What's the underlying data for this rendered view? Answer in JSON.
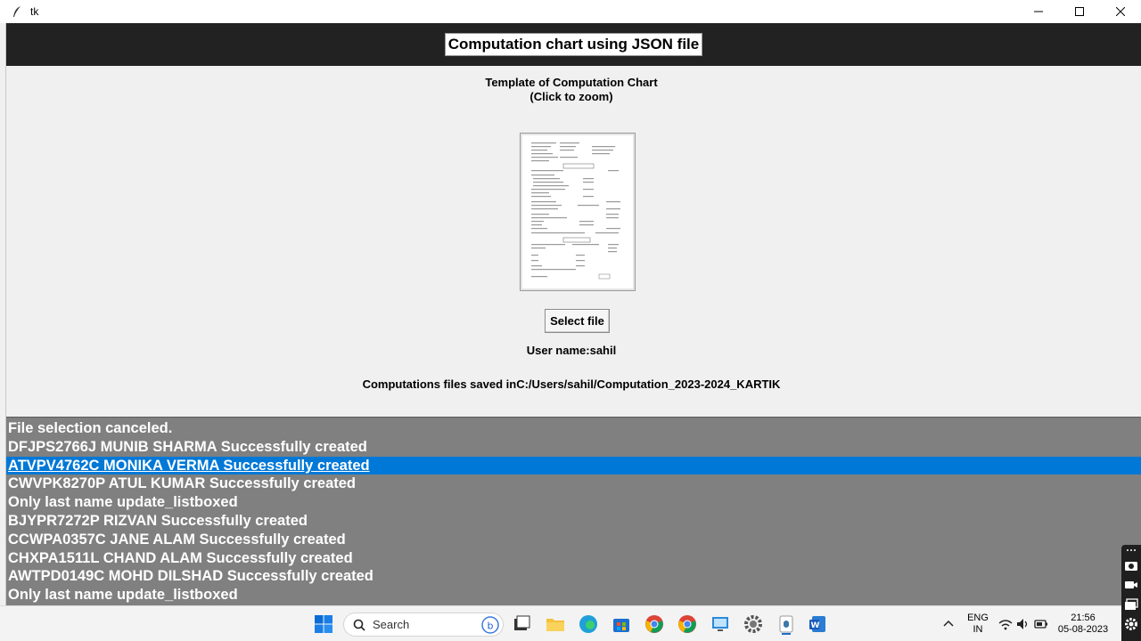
{
  "window": {
    "title": "tk"
  },
  "header": {
    "title": "Computation chart using JSON file"
  },
  "template": {
    "caption_line1": "Template of Computation Chart",
    "caption_line2": "(Click to zoom)"
  },
  "buttons": {
    "select_file": "Select file"
  },
  "user": {
    "label": "User name:sahil"
  },
  "saved": {
    "label": "Computations files saved inC:/Users/sahil/Computation_2023-2024_KARTIK"
  },
  "listbox": {
    "items": [
      "File selection canceled.",
      "DFJPS2766J MUNIB SHARMA  Successfully created",
      "ATVPV4762C MONIKA VERMA  Successfully created",
      "CWVPK8270P ATUL KUMAR  Successfully created",
      "Only last name update_listboxed",
      "BJYPR7272P  RIZVAN  Successfully created",
      "CCWPA0357C JANE ALAM  Successfully created",
      "CHXPA1511L CHAND ALAM  Successfully created",
      "AWTPD0149C MOHD DILSHAD  Successfully created",
      "Only last name update_listboxed"
    ],
    "selected_index": 2
  },
  "taskbar": {
    "search_placeholder": "Search",
    "lang_line1": "ENG",
    "lang_line2": "IN",
    "time": "21:56",
    "date": "05-08-2023"
  },
  "colors": {
    "header_bg": "#222222",
    "listbox_bg": "#808080",
    "selection": "#0078d7"
  }
}
